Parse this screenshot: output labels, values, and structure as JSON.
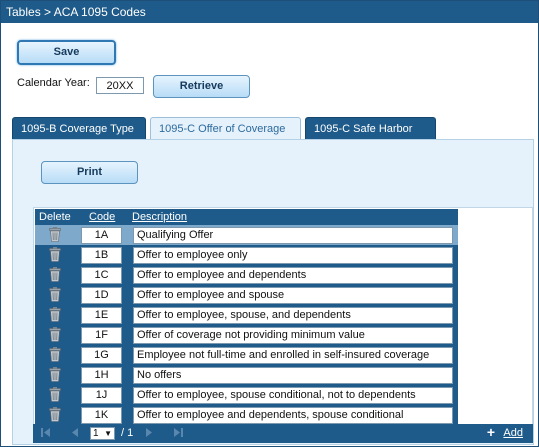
{
  "breadcrumb": "Tables > ACA 1095 Codes",
  "toolbar": {
    "save_label": "Save"
  },
  "calendar_year": {
    "label": "Calendar Year:",
    "value": "20XX",
    "retrieve_label": "Retrieve"
  },
  "tabs": [
    {
      "label": "1095-B Coverage Type",
      "active": false
    },
    {
      "label": "1095-C Offer of Coverage",
      "active": true
    },
    {
      "label": "1095-C Safe Harbor",
      "active": false
    }
  ],
  "print_label": "Print",
  "grid": {
    "headers": {
      "delete": "Delete",
      "code": "Code",
      "description": "Description"
    },
    "rows": [
      {
        "code": "1A",
        "description": "Qualifying Offer",
        "selected": true
      },
      {
        "code": "1B",
        "description": "Offer to employee only"
      },
      {
        "code": "1C",
        "description": "Offer to employee and dependents"
      },
      {
        "code": "1D",
        "description": "Offer to employee and spouse"
      },
      {
        "code": "1E",
        "description": "Offer to employee, spouse, and dependents"
      },
      {
        "code": "1F",
        "description": "Offer of coverage not providing minimum value"
      },
      {
        "code": "1G",
        "description": "Employee not full-time and enrolled in self-insured coverage"
      },
      {
        "code": "1H",
        "description": "No offers"
      },
      {
        "code": "1J",
        "description": "Offer to employee, spouse conditional, not to dependents"
      },
      {
        "code": "1K",
        "description": "Offer to employee and dependents, spouse conditional"
      }
    ]
  },
  "pager": {
    "page": "1",
    "total": "/ 1",
    "add_label": "Add"
  },
  "colors": {
    "header_blue": "#1e5b8a",
    "panel_bg": "#e5f1fb",
    "selected_row": "#7fa9cb"
  },
  "icons": {
    "delete": "trash-icon",
    "first": "first-page-icon",
    "prev": "prev-page-icon",
    "next": "next-page-icon",
    "last": "last-page-icon",
    "add": "plus-icon"
  }
}
